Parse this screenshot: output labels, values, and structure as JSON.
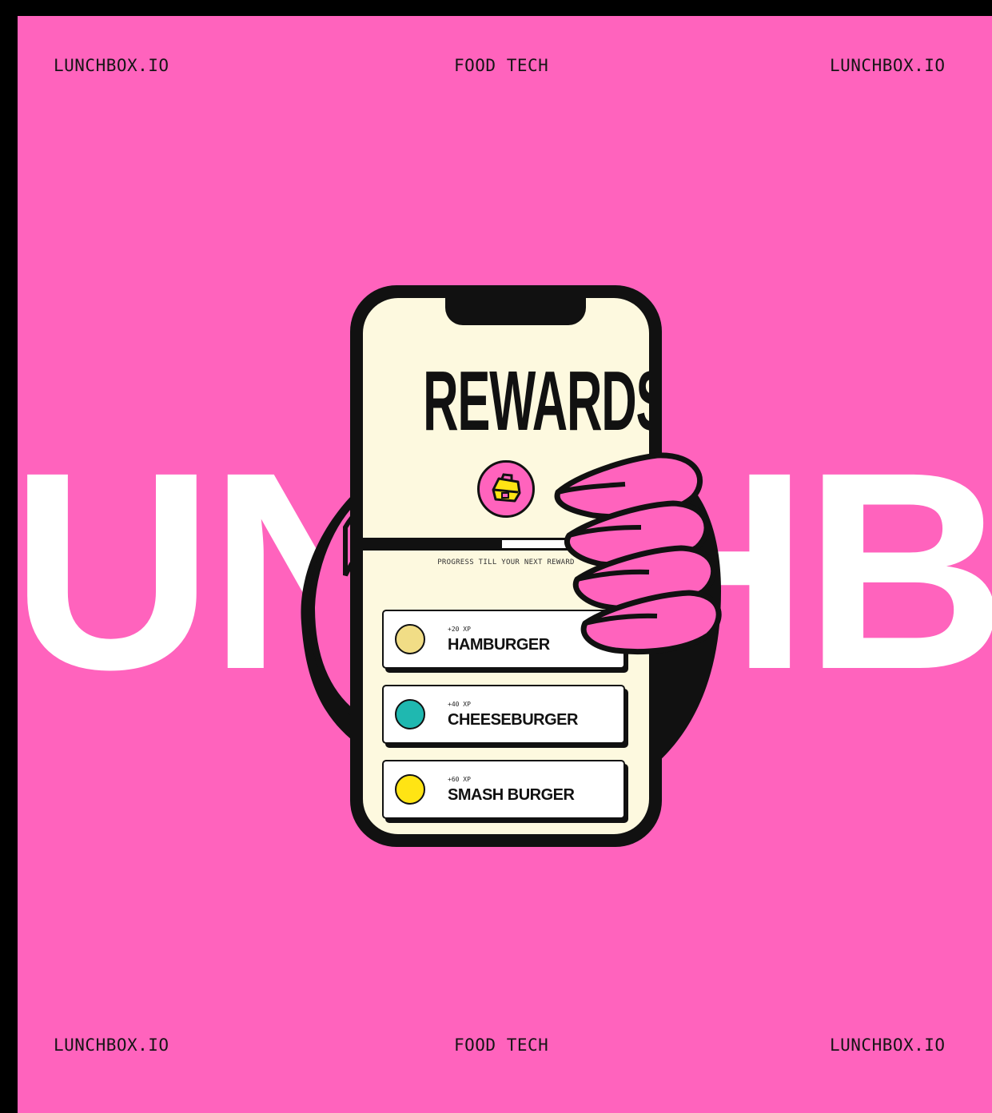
{
  "corners": {
    "top_left": "LUNCHBOX.IO",
    "top_center": "FOOD TECH",
    "top_right": "LUNCHBOX.IO",
    "bottom_left": "LUNCHBOX.IO",
    "bottom_center": "FOOD TECH",
    "bottom_right": "LUNCHBOX.IO"
  },
  "background_word": "LUNCHBOX",
  "phone": {
    "title": "REWARDS",
    "progress_label": "PROGRESS TILL YOUR NEXT REWARD",
    "progress_fraction": 0.6,
    "rewards": [
      {
        "xp": "+20 XP",
        "name": "HAMBURGER",
        "icon": "burger-icon",
        "icon_color": "#f1dd86"
      },
      {
        "xp": "+40 XP",
        "name": "CHEESEBURGER",
        "icon": "burger-icon",
        "icon_color": "#1fb8b0"
      },
      {
        "xp": "+60 XP",
        "name": "SMASH BURGER",
        "icon": "burger-icon",
        "icon_color": "#ffe414"
      }
    ]
  },
  "colors": {
    "background": "#ff63bd",
    "frame": "#000000",
    "screen": "#fdf9df",
    "lunchbox_icon": "#ffe414"
  }
}
